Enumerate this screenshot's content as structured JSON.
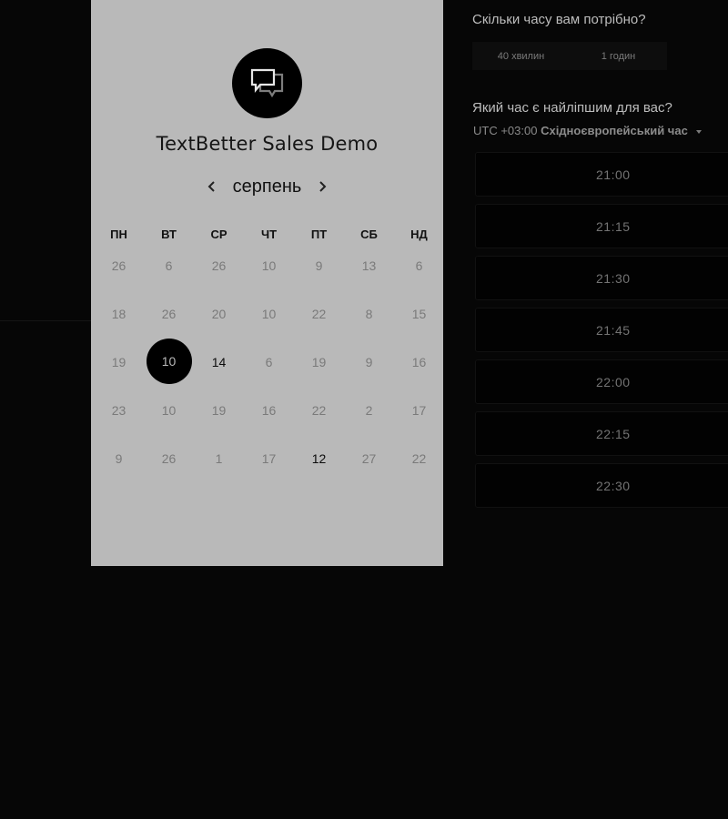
{
  "calendar": {
    "company_name": "TextBetter Sales Demo",
    "month": "серпень",
    "weekdays": [
      "ПН",
      "ВТ",
      "СР",
      "ЧТ",
      "ПТ",
      "СБ",
      "НД"
    ],
    "rows": [
      [
        "26",
        "6",
        "26",
        "10",
        "9",
        "13",
        "6"
      ],
      [
        "18",
        "26",
        "20",
        "10",
        "22",
        "8",
        "15"
      ],
      [
        "19",
        "10",
        "14",
        "6",
        "19",
        "9",
        "16"
      ],
      [
        "23",
        "10",
        "19",
        "16",
        "22",
        "2",
        "17"
      ],
      [
        "9",
        "26",
        "1",
        "17",
        "12",
        "27",
        "22"
      ]
    ]
  },
  "duration": {
    "question": "Скільки часу вам потрібно?",
    "options": [
      "40 хвилин",
      "1 годин"
    ]
  },
  "time": {
    "question": "Який час є найліпшим для вас?",
    "timezone_offset": "UTC +03:00",
    "timezone_name": "Східноєвропейський час",
    "slots": [
      "21:00",
      "21:15",
      "21:30",
      "21:45",
      "22:00",
      "22:15",
      "22:30"
    ]
  }
}
